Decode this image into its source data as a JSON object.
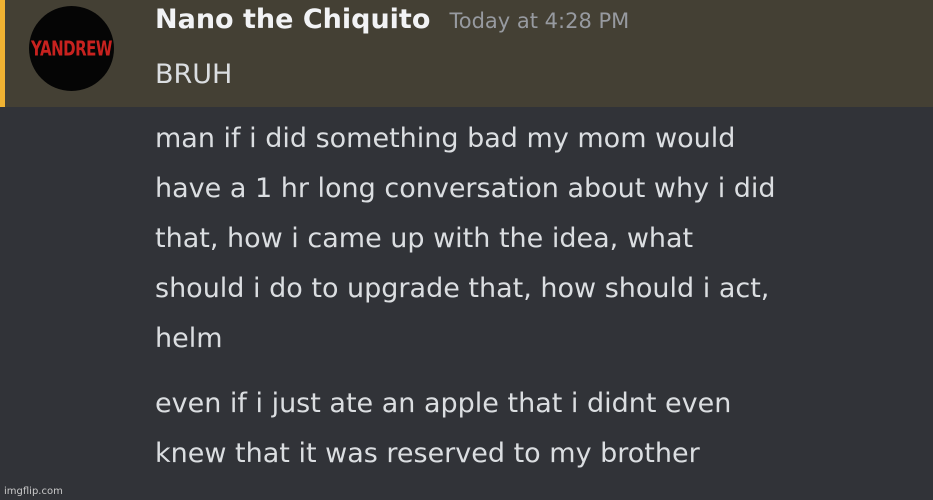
{
  "message": {
    "username": "Nano the Chiquito",
    "timestamp": "Today at 4:28 PM",
    "avatar_text": "YANDREW",
    "lines": [
      "BRUH"
    ]
  },
  "followups": [
    {
      "lines": [
        "man if i did something bad my mom would",
        "have a 1 hr long conversation about why i did",
        "that, how i came up with the idea, what",
        "should i do to upgrade that, how should i act,",
        "helm"
      ]
    },
    {
      "lines": [
        "even if i just ate an apple that i didnt even",
        "knew that it was reserved to my brother"
      ]
    }
  ],
  "watermark": "imgflip.com",
  "colors": {
    "background": "#313338",
    "highlight": "#444034",
    "highlight_bar": "#f0b232",
    "username": "#f2f3f5",
    "text": "#dbdee1",
    "timestamp": "#979aa0"
  }
}
